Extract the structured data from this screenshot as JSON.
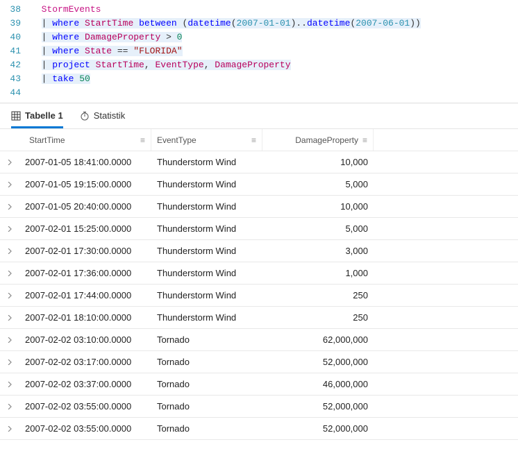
{
  "editor": {
    "lines": [
      {
        "num": 38,
        "tokens": [
          {
            "t": "StormEvents",
            "cls": "tbl"
          }
        ]
      },
      {
        "num": 39,
        "bg": "hl",
        "tokens": [
          {
            "t": "| ",
            "cls": "op"
          },
          {
            "t": "where",
            "cls": "kw"
          },
          {
            "t": " "
          },
          {
            "t": "StartTime",
            "cls": "col"
          },
          {
            "t": " "
          },
          {
            "t": "between",
            "cls": "kw"
          },
          {
            "t": " "
          },
          {
            "t": "(",
            "cls": "paren"
          },
          {
            "t": "datetime",
            "cls": "fn"
          },
          {
            "t": "(",
            "cls": "paren"
          },
          {
            "t": "2007-01-01",
            "cls": "dt"
          },
          {
            "t": ")",
            "cls": "paren"
          },
          {
            "t": "..",
            "cls": "op"
          },
          {
            "t": "datetime",
            "cls": "fn"
          },
          {
            "t": "(",
            "cls": "paren"
          },
          {
            "t": "2007-06-01",
            "cls": "dt"
          },
          {
            "t": ")",
            "cls": "paren"
          },
          {
            "t": ")",
            "cls": "paren"
          }
        ]
      },
      {
        "num": 40,
        "bg": "hl",
        "tokens": [
          {
            "t": "| ",
            "cls": "op"
          },
          {
            "t": "where",
            "cls": "kw"
          },
          {
            "t": " "
          },
          {
            "t": "DamageProperty",
            "cls": "col"
          },
          {
            "t": " > ",
            "cls": "op"
          },
          {
            "t": "0",
            "cls": "num"
          }
        ]
      },
      {
        "num": 41,
        "bg": "hl",
        "tokens": [
          {
            "t": "| ",
            "cls": "op"
          },
          {
            "t": "where",
            "cls": "kw"
          },
          {
            "t": " "
          },
          {
            "t": "State",
            "cls": "col"
          },
          {
            "t": " == ",
            "cls": "op"
          },
          {
            "t": "\"FLORIDA\"",
            "cls": "str"
          }
        ]
      },
      {
        "num": 42,
        "bg": "hl",
        "tokens": [
          {
            "t": "| ",
            "cls": "op"
          },
          {
            "t": "project",
            "cls": "kw"
          },
          {
            "t": " "
          },
          {
            "t": "StartTime",
            "cls": "col"
          },
          {
            "t": ", ",
            "cls": "op"
          },
          {
            "t": "EventType",
            "cls": "col"
          },
          {
            "t": ", ",
            "cls": "op"
          },
          {
            "t": "DamageProperty",
            "cls": "col"
          }
        ]
      },
      {
        "num": 43,
        "bg": "hl",
        "tokens": [
          {
            "t": "| ",
            "cls": "op"
          },
          {
            "t": "take",
            "cls": "kw"
          },
          {
            "t": " "
          },
          {
            "t": "50",
            "cls": "num"
          }
        ]
      },
      {
        "num": 44,
        "tokens": []
      }
    ]
  },
  "tabs": {
    "table_label": "Tabelle 1",
    "stats_label": "Statistik"
  },
  "results": {
    "headers": {
      "start": "StartTime",
      "event": "EventType",
      "damage": "DamageProperty"
    },
    "rows": [
      {
        "start": "2007-01-05 18:41:00.0000",
        "event": "Thunderstorm Wind",
        "damage": "10,000"
      },
      {
        "start": "2007-01-05 19:15:00.0000",
        "event": "Thunderstorm Wind",
        "damage": "5,000"
      },
      {
        "start": "2007-01-05 20:40:00.0000",
        "event": "Thunderstorm Wind",
        "damage": "10,000"
      },
      {
        "start": "2007-02-01 15:25:00.0000",
        "event": "Thunderstorm Wind",
        "damage": "5,000"
      },
      {
        "start": "2007-02-01 17:30:00.0000",
        "event": "Thunderstorm Wind",
        "damage": "3,000"
      },
      {
        "start": "2007-02-01 17:36:00.0000",
        "event": "Thunderstorm Wind",
        "damage": "1,000"
      },
      {
        "start": "2007-02-01 17:44:00.0000",
        "event": "Thunderstorm Wind",
        "damage": "250"
      },
      {
        "start": "2007-02-01 18:10:00.0000",
        "event": "Thunderstorm Wind",
        "damage": "250"
      },
      {
        "start": "2007-02-02 03:10:00.0000",
        "event": "Tornado",
        "damage": "62,000,000"
      },
      {
        "start": "2007-02-02 03:17:00.0000",
        "event": "Tornado",
        "damage": "52,000,000"
      },
      {
        "start": "2007-02-02 03:37:00.0000",
        "event": "Tornado",
        "damage": "46,000,000"
      },
      {
        "start": "2007-02-02 03:55:00.0000",
        "event": "Tornado",
        "damage": "52,000,000"
      },
      {
        "start": "2007-02-02 03:55:00.0000",
        "event": "Tornado",
        "damage": "52,000,000"
      }
    ]
  }
}
